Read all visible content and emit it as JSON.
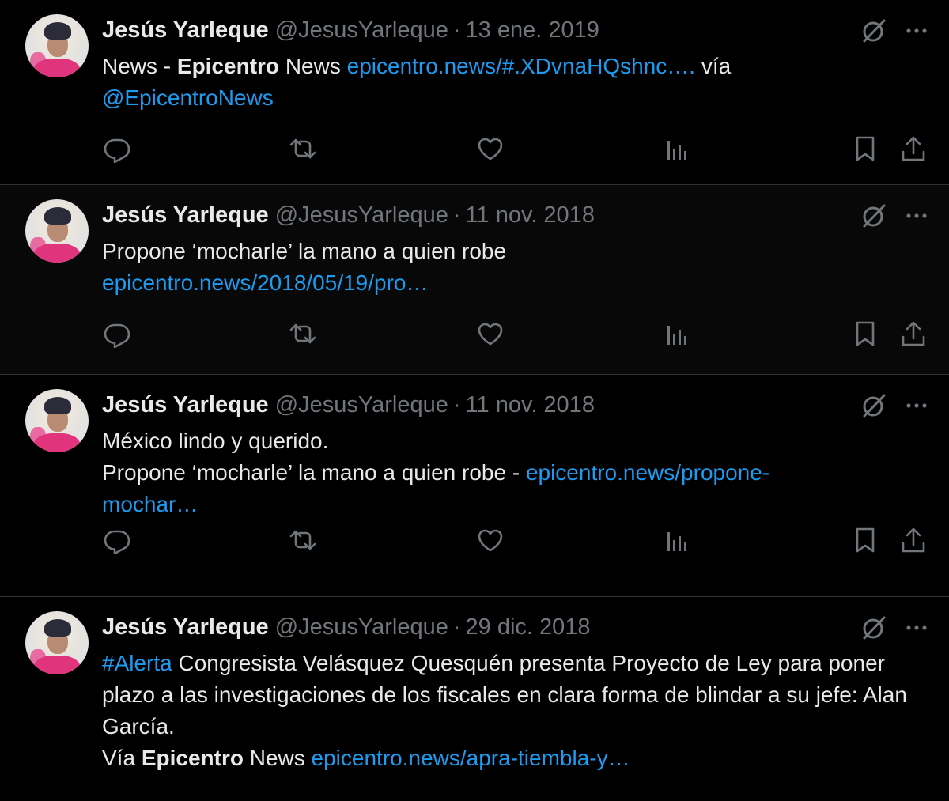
{
  "tweets": [
    {
      "author": "Jesús Yarleque",
      "handle": "@JesusYarleque",
      "date": "13 ene. 2019",
      "text_pre": "News - ",
      "bold1": "Epicentro",
      "text_mid": " News ",
      "link1": "epicentro.news/#.XDvnaHQshnc….",
      "text_via": " vía",
      "link2": "@EpicentroNews"
    },
    {
      "author": "Jesús Yarleque",
      "handle": "@JesusYarleque",
      "date": "11 nov. 2018",
      "line1": "Propone ‘mocharle’ la mano a quien robe",
      "link1": "epicentro.news/2018/05/19/pro…"
    },
    {
      "author": "Jesús Yarleque",
      "handle": "@JesusYarleque",
      "date": "11 nov. 2018",
      "line1": "México lindo y querido.",
      "line2": "Propone ‘mocharle’ la mano a quien robe - ",
      "link1": "epicentro.news/propone-",
      "link1b": "mochar…"
    },
    {
      "author": "Jesús Yarleque",
      "handle": "@JesusYarleque",
      "date": "29 dic. 2018",
      "hashtag": "#Alerta",
      "text1": " Congresista Velásquez Quesquén presenta Proyecto de Ley para poner plazo a las investigaciones de los fiscales en clara forma de blindar a su jefe: Alan García.",
      "via_pre": "Vía ",
      "bold1": "Epicentro",
      "via_mid": " News ",
      "link1": "epicentro.news/apra-tiembla-y…"
    }
  ],
  "icons": {
    "grok": "grok-icon",
    "more": "more-icon",
    "reply": "reply-icon",
    "retweet": "retweet-icon",
    "like": "like-icon",
    "views": "views-icon",
    "bookmark": "bookmark-icon",
    "share": "share-icon"
  },
  "colors": {
    "background": "#000000",
    "text": "#e7e9ea",
    "muted": "#71767b",
    "link": "#1d9bf0",
    "divider": "#2f3336"
  }
}
